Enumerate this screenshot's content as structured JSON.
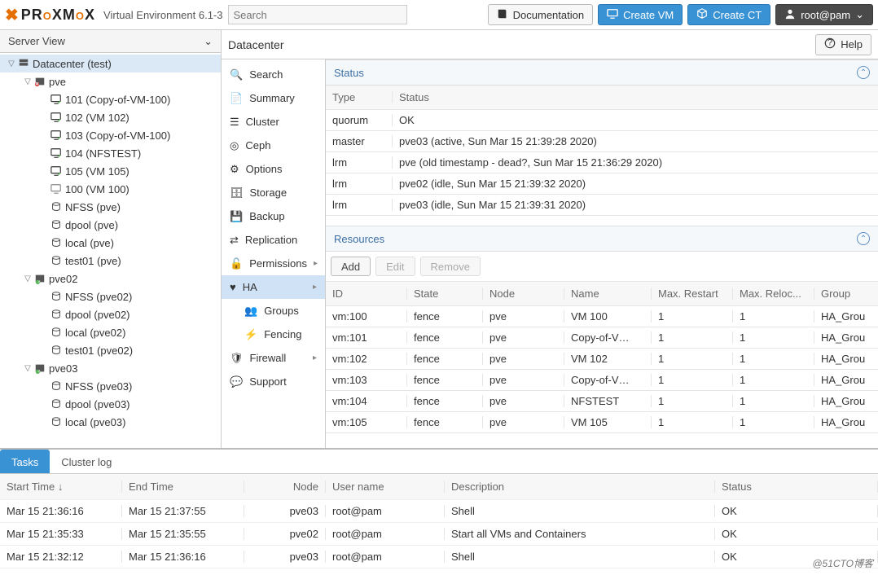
{
  "header": {
    "product": "PROXMOX",
    "ve_label": "Virtual Environment 6.1-3",
    "search_placeholder": "Search",
    "doc_label": "Documentation",
    "create_vm": "Create VM",
    "create_ct": "Create CT",
    "user": "root@pam"
  },
  "left": {
    "view_mode": "Server View",
    "tree": [
      {
        "depth": 0,
        "caret": "v",
        "icon": "datacenter",
        "label": "Datacenter (test)",
        "selected": true,
        "interact": true
      },
      {
        "depth": 1,
        "caret": "v",
        "icon": "node-err",
        "label": "pve",
        "interact": true
      },
      {
        "depth": 2,
        "caret": "",
        "icon": "vm-run",
        "label": "101 (Copy-of-VM-100)",
        "interact": true
      },
      {
        "depth": 2,
        "caret": "",
        "icon": "vm-run",
        "label": "102 (VM 102)",
        "interact": true
      },
      {
        "depth": 2,
        "caret": "",
        "icon": "vm-run",
        "label": "103 (Copy-of-VM-100)",
        "interact": true
      },
      {
        "depth": 2,
        "caret": "",
        "icon": "vm-run",
        "label": "104 (NFSTEST)",
        "interact": true
      },
      {
        "depth": 2,
        "caret": "",
        "icon": "vm-run",
        "label": "105 (VM 105)",
        "interact": true
      },
      {
        "depth": 2,
        "caret": "",
        "icon": "vm-stop",
        "label": "100 (VM 100)",
        "interact": true
      },
      {
        "depth": 2,
        "caret": "",
        "icon": "storage",
        "label": "NFSS (pve)",
        "interact": true
      },
      {
        "depth": 2,
        "caret": "",
        "icon": "storage",
        "label": "dpool (pve)",
        "interact": true
      },
      {
        "depth": 2,
        "caret": "",
        "icon": "storage",
        "label": "local (pve)",
        "interact": true
      },
      {
        "depth": 2,
        "caret": "",
        "icon": "storage",
        "label": "test01 (pve)",
        "interact": true
      },
      {
        "depth": 1,
        "caret": "v",
        "icon": "node-ok",
        "label": "pve02",
        "interact": true
      },
      {
        "depth": 2,
        "caret": "",
        "icon": "storage",
        "label": "NFSS (pve02)",
        "interact": true
      },
      {
        "depth": 2,
        "caret": "",
        "icon": "storage",
        "label": "dpool (pve02)",
        "interact": true
      },
      {
        "depth": 2,
        "caret": "",
        "icon": "storage",
        "label": "local (pve02)",
        "interact": true
      },
      {
        "depth": 2,
        "caret": "",
        "icon": "storage",
        "label": "test01 (pve02)",
        "interact": true
      },
      {
        "depth": 1,
        "caret": "v",
        "icon": "node-ok",
        "label": "pve03",
        "interact": true
      },
      {
        "depth": 2,
        "caret": "",
        "icon": "storage",
        "label": "NFSS (pve03)",
        "interact": true
      },
      {
        "depth": 2,
        "caret": "",
        "icon": "storage",
        "label": "dpool (pve03)",
        "interact": true
      },
      {
        "depth": 2,
        "caret": "",
        "icon": "storage",
        "label": "local (pve03)",
        "interact": true
      }
    ]
  },
  "main": {
    "breadcrumb": "Datacenter",
    "help_label": "Help",
    "nav": [
      {
        "icon": "search",
        "label": "Search"
      },
      {
        "icon": "summary",
        "label": "Summary"
      },
      {
        "icon": "cluster",
        "label": "Cluster"
      },
      {
        "icon": "ceph",
        "label": "Ceph"
      },
      {
        "icon": "options",
        "label": "Options"
      },
      {
        "icon": "storage",
        "label": "Storage"
      },
      {
        "icon": "backup",
        "label": "Backup"
      },
      {
        "icon": "replication",
        "label": "Replication"
      },
      {
        "icon": "permissions",
        "label": "Permissions",
        "chev": true
      },
      {
        "icon": "ha",
        "label": "HA",
        "active": true,
        "chev": true
      },
      {
        "icon": "groups",
        "label": "Groups",
        "sub": true
      },
      {
        "icon": "fencing",
        "label": "Fencing",
        "sub": true
      },
      {
        "icon": "firewall",
        "label": "Firewall",
        "chev": true
      },
      {
        "icon": "support",
        "label": "Support"
      }
    ],
    "status": {
      "title": "Status",
      "cols": {
        "type": "Type",
        "status": "Status"
      },
      "rows": [
        {
          "type": "quorum",
          "status": "OK"
        },
        {
          "type": "master",
          "status": "pve03 (active, Sun Mar 15 21:39:28 2020)"
        },
        {
          "type": "lrm",
          "status": "pve (old timestamp - dead?, Sun Mar 15 21:36:29 2020)"
        },
        {
          "type": "lrm",
          "status": "pve02 (idle, Sun Mar 15 21:39:32 2020)"
        },
        {
          "type": "lrm",
          "status": "pve03 (idle, Sun Mar 15 21:39:31 2020)"
        }
      ]
    },
    "resources": {
      "title": "Resources",
      "buttons": {
        "add": "Add",
        "edit": "Edit",
        "remove": "Remove"
      },
      "cols": {
        "id": "ID",
        "state": "State",
        "node": "Node",
        "name": "Name",
        "max_restart": "Max. Restart",
        "max_reloc": "Max. Reloc...",
        "group": "Group"
      },
      "rows": [
        {
          "id": "vm:100",
          "state": "fence",
          "node": "pve",
          "name": "VM 100",
          "mr": "1",
          "ml": "1",
          "group": "HA_Grou"
        },
        {
          "id": "vm:101",
          "state": "fence",
          "node": "pve",
          "name": "Copy-of-V…",
          "mr": "1",
          "ml": "1",
          "group": "HA_Grou"
        },
        {
          "id": "vm:102",
          "state": "fence",
          "node": "pve",
          "name": "VM 102",
          "mr": "1",
          "ml": "1",
          "group": "HA_Grou"
        },
        {
          "id": "vm:103",
          "state": "fence",
          "node": "pve",
          "name": "Copy-of-V…",
          "mr": "1",
          "ml": "1",
          "group": "HA_Grou"
        },
        {
          "id": "vm:104",
          "state": "fence",
          "node": "pve",
          "name": "NFSTEST",
          "mr": "1",
          "ml": "1",
          "group": "HA_Grou"
        },
        {
          "id": "vm:105",
          "state": "fence",
          "node": "pve",
          "name": "VM 105",
          "mr": "1",
          "ml": "1",
          "group": "HA_Grou"
        }
      ]
    }
  },
  "bottom": {
    "tabs": {
      "tasks": "Tasks",
      "cluster_log": "Cluster log"
    },
    "cols": {
      "start": "Start Time ↓",
      "end": "End Time",
      "node": "Node",
      "user": "User name",
      "desc": "Description",
      "status": "Status"
    },
    "rows": [
      {
        "start": "Mar 15 21:36:16",
        "end": "Mar 15 21:37:55",
        "node": "pve03",
        "user": "root@pam",
        "desc": "Shell",
        "status": "OK"
      },
      {
        "start": "Mar 15 21:35:33",
        "end": "Mar 15 21:35:55",
        "node": "pve02",
        "user": "root@pam",
        "desc": "Start all VMs and Containers",
        "status": "OK"
      },
      {
        "start": "Mar 15 21:32:12",
        "end": "Mar 15 21:36:16",
        "node": "pve03",
        "user": "root@pam",
        "desc": "Shell",
        "status": "OK"
      }
    ]
  },
  "watermark": "@51CTO博客"
}
